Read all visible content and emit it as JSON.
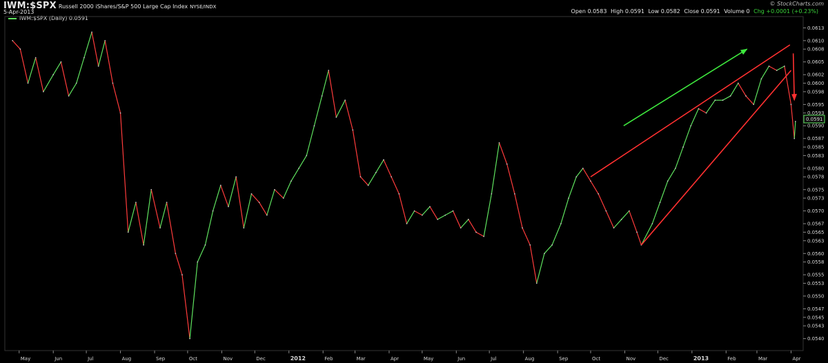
{
  "header": {
    "symbol": "IWM:$SPX",
    "name": "Russell 2000 iShares/S&P 500 Large Cap Index",
    "exchange": "NYSE/INDX",
    "date": "5-Apr-2013",
    "brand": "© StockCharts.com",
    "ohlc": {
      "open": "Open 0.0583",
      "high": "High 0.0591",
      "low": "Low 0.0582",
      "close": "Close 0.0591",
      "volume": "Volume 0",
      "chg": "Chg +0.0001 (+0.23%)"
    }
  },
  "legend": {
    "label": "IWM:$SPX (Daily) 0.0591"
  },
  "last_value_label": "0.0591",
  "colors": {
    "up": "#5fe35f",
    "down": "#ff3b3b",
    "background": "#000000",
    "axis": "#d6d6d6",
    "green_arrow": "#3ee83e",
    "red_lines": "#ff3030"
  },
  "chart_data": {
    "type": "line",
    "title": "IWM:$SPX Russell 2000 iShares/S&P 500 Large Cap Index",
    "ylim": [
      0.0538,
      0.0615
    ],
    "y_ticks": [
      "0.0613",
      "0.0610",
      "0.0608",
      "0.0605",
      "0.0602",
      "0.0600",
      "0.0598",
      "0.0595",
      "0.0593",
      "0.0590",
      "0.0587",
      "0.0585",
      "0.0583",
      "0.0580",
      "0.0578",
      "0.0575",
      "0.0573",
      "0.0570",
      "0.0567",
      "0.0565",
      "0.0563",
      "0.0560",
      "0.0558",
      "0.0555",
      "0.0553",
      "0.0550",
      "0.0547",
      "0.0545",
      "0.0543",
      "0.0540"
    ],
    "x_ticks": [
      "May",
      "Jun",
      "Jul",
      "Aug",
      "Sep",
      "Oct",
      "Nov",
      "Dec",
      "2012",
      "Feb",
      "Mar",
      "Apr",
      "May",
      "Jun",
      "Jul",
      "Aug",
      "Sep",
      "Oct",
      "Nov",
      "Dec",
      "2013",
      "Feb",
      "Mar",
      "Apr"
    ],
    "bold_ticks": [
      "2012",
      "2013"
    ],
    "series": [
      {
        "values": [
          {
            "x": "2011-04-25",
            "y": 0.061
          },
          {
            "x": "2011-05-02",
            "y": 0.0608
          },
          {
            "x": "2011-05-09",
            "y": 0.06
          },
          {
            "x": "2011-05-16",
            "y": 0.0606
          },
          {
            "x": "2011-05-23",
            "y": 0.0598
          },
          {
            "x": "2011-06-01",
            "y": 0.0602
          },
          {
            "x": "2011-06-08",
            "y": 0.0605
          },
          {
            "x": "2011-06-15",
            "y": 0.0597
          },
          {
            "x": "2011-06-22",
            "y": 0.06
          },
          {
            "x": "2011-06-29",
            "y": 0.0606
          },
          {
            "x": "2011-07-06",
            "y": 0.0612
          },
          {
            "x": "2011-07-12",
            "y": 0.0604
          },
          {
            "x": "2011-07-18",
            "y": 0.061
          },
          {
            "x": "2011-07-25",
            "y": 0.06
          },
          {
            "x": "2011-08-01",
            "y": 0.0593
          },
          {
            "x": "2011-08-08",
            "y": 0.0565
          },
          {
            "x": "2011-08-15",
            "y": 0.0572
          },
          {
            "x": "2011-08-22",
            "y": 0.0562
          },
          {
            "x": "2011-08-29",
            "y": 0.0575
          },
          {
            "x": "2011-09-06",
            "y": 0.0566
          },
          {
            "x": "2011-09-12",
            "y": 0.0572
          },
          {
            "x": "2011-09-20",
            "y": 0.056
          },
          {
            "x": "2011-09-26",
            "y": 0.0555
          },
          {
            "x": "2011-10-03",
            "y": 0.054
          },
          {
            "x": "2011-10-10",
            "y": 0.0558
          },
          {
            "x": "2011-10-17",
            "y": 0.0562
          },
          {
            "x": "2011-10-24",
            "y": 0.057
          },
          {
            "x": "2011-10-31",
            "y": 0.0576
          },
          {
            "x": "2011-11-07",
            "y": 0.0571
          },
          {
            "x": "2011-11-14",
            "y": 0.0578
          },
          {
            "x": "2011-11-21",
            "y": 0.0566
          },
          {
            "x": "2011-11-28",
            "y": 0.0574
          },
          {
            "x": "2011-12-05",
            "y": 0.0572
          },
          {
            "x": "2011-12-12",
            "y": 0.0569
          },
          {
            "x": "2011-12-19",
            "y": 0.0575
          },
          {
            "x": "2011-12-27",
            "y": 0.0573
          },
          {
            "x": "2012-01-03",
            "y": 0.0577
          },
          {
            "x": "2012-01-10",
            "y": 0.058
          },
          {
            "x": "2012-01-17",
            "y": 0.0583
          },
          {
            "x": "2012-01-24",
            "y": 0.059
          },
          {
            "x": "2012-01-31",
            "y": 0.0597
          },
          {
            "x": "2012-02-06",
            "y": 0.0603
          },
          {
            "x": "2012-02-13",
            "y": 0.0592
          },
          {
            "x": "2012-02-21",
            "y": 0.0596
          },
          {
            "x": "2012-02-28",
            "y": 0.0589
          },
          {
            "x": "2012-03-06",
            "y": 0.0578
          },
          {
            "x": "2012-03-13",
            "y": 0.0576
          },
          {
            "x": "2012-03-20",
            "y": 0.0579
          },
          {
            "x": "2012-03-27",
            "y": 0.0582
          },
          {
            "x": "2012-04-03",
            "y": 0.0578
          },
          {
            "x": "2012-04-10",
            "y": 0.0574
          },
          {
            "x": "2012-04-17",
            "y": 0.0567
          },
          {
            "x": "2012-04-24",
            "y": 0.057
          },
          {
            "x": "2012-05-01",
            "y": 0.0569
          },
          {
            "x": "2012-05-08",
            "y": 0.0571
          },
          {
            "x": "2012-05-15",
            "y": 0.0568
          },
          {
            "x": "2012-05-22",
            "y": 0.0569
          },
          {
            "x": "2012-05-29",
            "y": 0.057
          },
          {
            "x": "2012-06-05",
            "y": 0.0566
          },
          {
            "x": "2012-06-12",
            "y": 0.0568
          },
          {
            "x": "2012-06-19",
            "y": 0.0565
          },
          {
            "x": "2012-06-26",
            "y": 0.0564
          },
          {
            "x": "2012-07-03",
            "y": 0.0574
          },
          {
            "x": "2012-07-10",
            "y": 0.0586
          },
          {
            "x": "2012-07-17",
            "y": 0.0581
          },
          {
            "x": "2012-07-24",
            "y": 0.0574
          },
          {
            "x": "2012-07-31",
            "y": 0.0566
          },
          {
            "x": "2012-08-07",
            "y": 0.0562
          },
          {
            "x": "2012-08-13",
            "y": 0.0553
          },
          {
            "x": "2012-08-20",
            "y": 0.056
          },
          {
            "x": "2012-08-27",
            "y": 0.0562
          },
          {
            "x": "2012-09-04",
            "y": 0.0567
          },
          {
            "x": "2012-09-11",
            "y": 0.0573
          },
          {
            "x": "2012-09-18",
            "y": 0.0578
          },
          {
            "x": "2012-09-24",
            "y": 0.058
          },
          {
            "x": "2012-10-01",
            "y": 0.0577
          },
          {
            "x": "2012-10-08",
            "y": 0.0574
          },
          {
            "x": "2012-10-15",
            "y": 0.057
          },
          {
            "x": "2012-10-22",
            "y": 0.0566
          },
          {
            "x": "2012-10-29",
            "y": 0.0568
          },
          {
            "x": "2012-11-05",
            "y": 0.057
          },
          {
            "x": "2012-11-12",
            "y": 0.0565
          },
          {
            "x": "2012-11-16",
            "y": 0.0562
          },
          {
            "x": "2012-11-26",
            "y": 0.0567
          },
          {
            "x": "2012-12-03",
            "y": 0.0572
          },
          {
            "x": "2012-12-10",
            "y": 0.0577
          },
          {
            "x": "2012-12-17",
            "y": 0.058
          },
          {
            "x": "2012-12-24",
            "y": 0.0585
          },
          {
            "x": "2012-12-31",
            "y": 0.059
          },
          {
            "x": "2013-01-07",
            "y": 0.0594
          },
          {
            "x": "2013-01-14",
            "y": 0.0593
          },
          {
            "x": "2013-01-22",
            "y": 0.0596
          },
          {
            "x": "2013-01-29",
            "y": 0.0596
          },
          {
            "x": "2013-02-05",
            "y": 0.0597
          },
          {
            "x": "2013-02-12",
            "y": 0.06
          },
          {
            "x": "2013-02-19",
            "y": 0.0597
          },
          {
            "x": "2013-02-26",
            "y": 0.0595
          },
          {
            "x": "2013-03-05",
            "y": 0.0601
          },
          {
            "x": "2013-03-12",
            "y": 0.0604
          },
          {
            "x": "2013-03-19",
            "y": 0.0603
          },
          {
            "x": "2013-03-26",
            "y": 0.0604
          },
          {
            "x": "2013-04-01",
            "y": 0.0595
          },
          {
            "x": "2013-04-04",
            "y": 0.0587
          },
          {
            "x": "2013-04-05",
            "y": 0.0591
          }
        ]
      }
    ],
    "annotations": [
      {
        "type": "arrow",
        "color": "green",
        "from": {
          "x": "2012-10-31",
          "y": 0.059
        },
        "to": {
          "x": "2013-02-20",
          "y": 0.0608
        }
      },
      {
        "type": "line",
        "color": "red",
        "from": {
          "x": "2012-10-01",
          "y": 0.0578
        },
        "to": {
          "x": "2013-03-31",
          "y": 0.0609
        }
      },
      {
        "type": "line",
        "color": "red",
        "from": {
          "x": "2012-11-16",
          "y": 0.0562
        },
        "to": {
          "x": "2013-04-01",
          "y": 0.0603
        }
      },
      {
        "type": "arrow",
        "color": "red",
        "from": {
          "x": "2013-04-03",
          "y": 0.0607
        },
        "to": {
          "x": "2013-04-04",
          "y": 0.0596
        }
      }
    ]
  }
}
